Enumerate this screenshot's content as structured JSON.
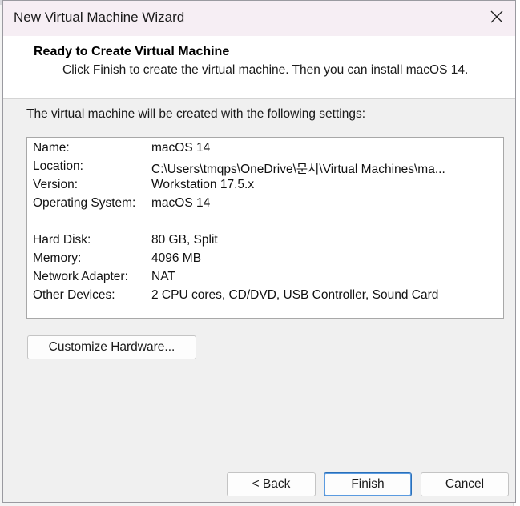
{
  "window": {
    "title": "New Virtual Machine Wizard",
    "close_icon": "close-icon"
  },
  "header": {
    "title": "Ready to Create Virtual Machine",
    "description": "Click Finish to create the virtual machine. Then you can install macOS 14."
  },
  "content": {
    "intro": "The virtual machine will be created with the following settings:",
    "settings": [
      {
        "key": "Name:",
        "value": "macOS 14"
      },
      {
        "key": "Location:",
        "value": "C:\\Users\\tmqps\\OneDrive\\문서\\Virtual Machines\\ma..."
      },
      {
        "key": "Version:",
        "value": "Workstation 17.5.x"
      },
      {
        "key": "Operating System:",
        "value": "macOS 14"
      },
      {
        "key": "Hard Disk:",
        "value": "80 GB, Split"
      },
      {
        "key": "Memory:",
        "value": "4096 MB"
      },
      {
        "key": "Network Adapter:",
        "value": "NAT"
      },
      {
        "key": "Other Devices:",
        "value": "2 CPU cores, CD/DVD, USB Controller, Sound Card"
      }
    ],
    "customize_label": "Customize Hardware..."
  },
  "footer": {
    "back_label": "< Back",
    "finish_label": "Finish",
    "cancel_label": "Cancel"
  },
  "colors": {
    "titlebar": "#f6eef4",
    "content_bg": "#f0f0f0",
    "primary_border": "#2a6fb8"
  }
}
